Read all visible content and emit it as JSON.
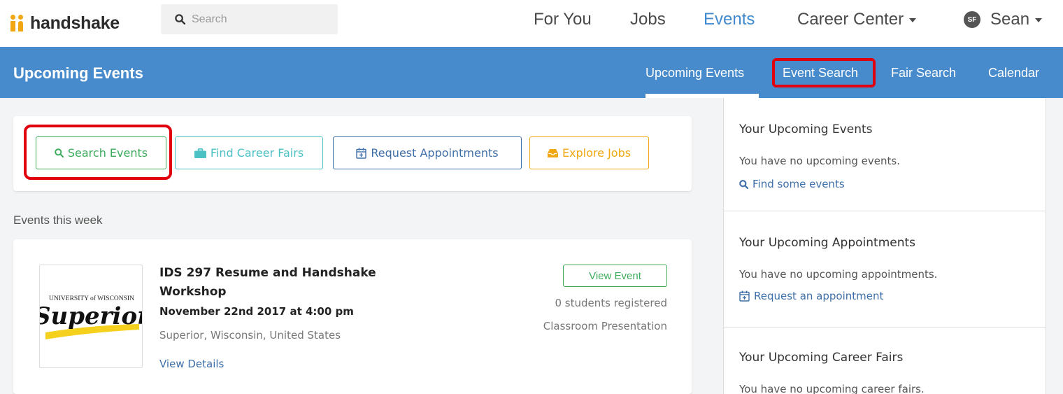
{
  "brand": {
    "name": "handshake",
    "color": "#f1a712"
  },
  "top_search": {
    "placeholder": "Search"
  },
  "top_nav": {
    "items": [
      "For You",
      "Jobs",
      "Events",
      "Career Center"
    ],
    "active": "Events",
    "user": {
      "initials": "SF",
      "name": "Sean"
    }
  },
  "page_header": {
    "title": "Upcoming Events",
    "tabs": [
      "Upcoming Events",
      "Event Search",
      "Fair Search",
      "Calendar"
    ],
    "active_tab": "Upcoming Events",
    "highlighted_tab": "Event Search",
    "bg_color": "#478bcc"
  },
  "actions": [
    {
      "label": "Search Events",
      "icon": "search-icon",
      "color": "#3cab5c"
    },
    {
      "label": "Find Career Fairs",
      "icon": "briefcase-icon",
      "color": "#4cc1c4"
    },
    {
      "label": "Request Appointments",
      "icon": "calendar-plus-icon",
      "color": "#3f6fa8"
    },
    {
      "label": "Explore Jobs",
      "icon": "inbox-icon",
      "color": "#f1a712"
    }
  ],
  "section_label": "Events this week",
  "event": {
    "title": "IDS 297 Resume and Handshake Workshop",
    "date": "November 22nd 2017 at 4:00 pm",
    "location": "Superior, Wisconsin, United States",
    "details_link": "View Details",
    "view_button": "View Event",
    "registered": "0 students registered",
    "type": "Classroom Presentation",
    "logo": {
      "university": "UNIVERSITY of WISCONSIN",
      "campus": "Superior"
    }
  },
  "sidebar": {
    "events": {
      "title": "Your Upcoming Events",
      "text": "You have no upcoming events.",
      "link": "Find some events"
    },
    "appointments": {
      "title": "Your Upcoming Appointments",
      "text": "You have no upcoming appointments.",
      "link": "Request an appointment"
    },
    "fairs": {
      "title": "Your Upcoming Career Fairs",
      "text": "You have no upcoming career fairs."
    }
  }
}
